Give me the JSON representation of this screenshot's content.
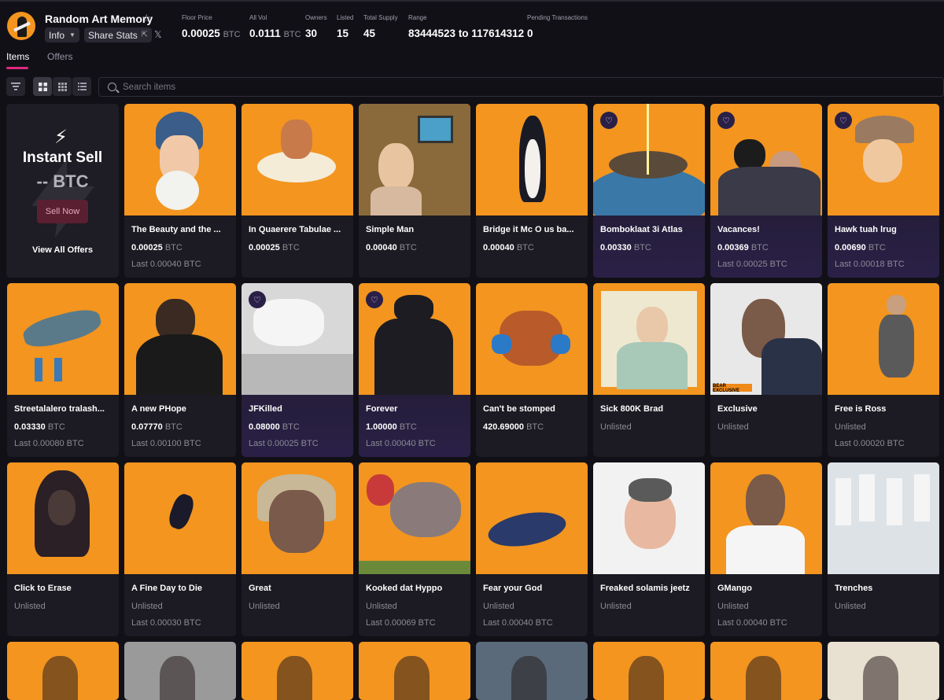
{
  "header": {
    "collection_name": "Random Art Memory",
    "info_label": "Info",
    "share_label": "Share Stats",
    "stats": [
      {
        "label": "Floor Price",
        "value": "0.00025",
        "unit": "BTC"
      },
      {
        "label": "All Vol",
        "value": "0.0111",
        "unit": "BTC"
      },
      {
        "label": "Owners",
        "value": "30",
        "unit": ""
      },
      {
        "label": "Listed",
        "value": "15",
        "unit": ""
      },
      {
        "label": "Total Supply",
        "value": "45",
        "unit": ""
      },
      {
        "label": "Range",
        "value": "83444523 to 117614312",
        "unit": ""
      },
      {
        "label": "Pending Transactions",
        "value": "0",
        "unit": ""
      }
    ]
  },
  "tabs": [
    {
      "label": "Items",
      "active": true
    },
    {
      "label": "Offers",
      "active": false
    }
  ],
  "search": {
    "placeholder": "Search items"
  },
  "instant_sell": {
    "title": "Instant Sell",
    "amount": "-- BTC",
    "button": "Sell Now",
    "view_all": "View All Offers"
  },
  "items": [
    {
      "name": "The Beauty and the ...",
      "price": "0.00025",
      "unit": "BTC",
      "last": "Last 0.00040 BTC",
      "badge": false
    },
    {
      "name": "In Quaerere Tabulae ...",
      "price": "0.00025",
      "unit": "BTC",
      "last": "",
      "badge": false
    },
    {
      "name": "Simple Man",
      "price": "0.00040",
      "unit": "BTC",
      "last": "",
      "badge": false
    },
    {
      "name": "Bridge it Mc O us ba...",
      "price": "0.00040",
      "unit": "BTC",
      "last": "",
      "badge": false
    },
    {
      "name": "Bomboklaat 3i Atlas",
      "price": "0.00330",
      "unit": "BTC",
      "last": "",
      "badge": true
    },
    {
      "name": "Vacances!",
      "price": "0.00369",
      "unit": "BTC",
      "last": "Last 0.00025 BTC",
      "badge": true
    },
    {
      "name": "Hawk tuah lrug",
      "price": "0.00690",
      "unit": "BTC",
      "last": "Last 0.00018 BTC",
      "badge": true
    },
    {
      "name": "Streetalalero tralash...",
      "price": "0.03330",
      "unit": "BTC",
      "last": "Last 0.00080 BTC",
      "badge": false
    },
    {
      "name": "A new PHope",
      "price": "0.07770",
      "unit": "BTC",
      "last": "Last 0.00100 BTC",
      "badge": false
    },
    {
      "name": "JFKilled",
      "price": "0.08000",
      "unit": "BTC",
      "last": "Last 0.00025 BTC",
      "badge": true
    },
    {
      "name": "Forever",
      "price": "1.00000",
      "unit": "BTC",
      "last": "Last 0.00040 BTC",
      "badge": true
    },
    {
      "name": "Can't be stomped",
      "price": "420.69000",
      "unit": "BTC",
      "last": "",
      "badge": false
    },
    {
      "name": "Sick 800K Brad",
      "price": "",
      "unit": "",
      "unlisted": "Unlisted",
      "last": "",
      "badge": false
    },
    {
      "name": "Exclusive",
      "price": "",
      "unit": "",
      "unlisted": "Unlisted",
      "last": "",
      "badge": false
    },
    {
      "name": "Free is Ross",
      "price": "",
      "unit": "",
      "unlisted": "Unlisted",
      "last": "Last 0.00020 BTC",
      "badge": false
    },
    {
      "name": "Click to Erase",
      "price": "",
      "unit": "",
      "unlisted": "Unlisted",
      "last": "",
      "badge": false
    },
    {
      "name": "A Fine Day to Die",
      "price": "",
      "unit": "",
      "unlisted": "Unlisted",
      "last": "Last 0.00030 BTC",
      "badge": false
    },
    {
      "name": "Great",
      "price": "",
      "unit": "",
      "unlisted": "Unlisted",
      "last": "",
      "badge": false
    },
    {
      "name": "Kooked dat Hyppo",
      "price": "",
      "unit": "",
      "unlisted": "Unlisted",
      "last": "Last 0.00069 BTC",
      "badge": false
    },
    {
      "name": "Fear your God",
      "price": "",
      "unit": "",
      "unlisted": "Unlisted",
      "last": "Last 0.00040 BTC",
      "badge": false
    },
    {
      "name": "Freaked solamis jeetz",
      "price": "",
      "unit": "",
      "unlisted": "Unlisted",
      "last": "",
      "badge": false
    },
    {
      "name": "GMango",
      "price": "",
      "unit": "",
      "unlisted": "Unlisted",
      "last": "Last 0.00040 BTC",
      "badge": false
    },
    {
      "name": "Trenches",
      "price": "",
      "unit": "",
      "unlisted": "Unlisted",
      "last": "",
      "badge": false
    }
  ],
  "bottom_row_count": 8,
  "image_label": "BEAR EXCLUSIVE",
  "colors": {
    "background": "#121017",
    "card": "#1c1a22",
    "art_orange": "#f3951f",
    "accent_pink": "#e0287f",
    "badge_purple": "#2a2047"
  },
  "icons": [
    "star-icon",
    "chevron-down-icon",
    "share-icon",
    "x-logo-icon",
    "filter-icon",
    "grid-large-icon",
    "grid-small-icon",
    "list-icon",
    "search-icon",
    "lightning-icon",
    "rare-badge-icon"
  ]
}
